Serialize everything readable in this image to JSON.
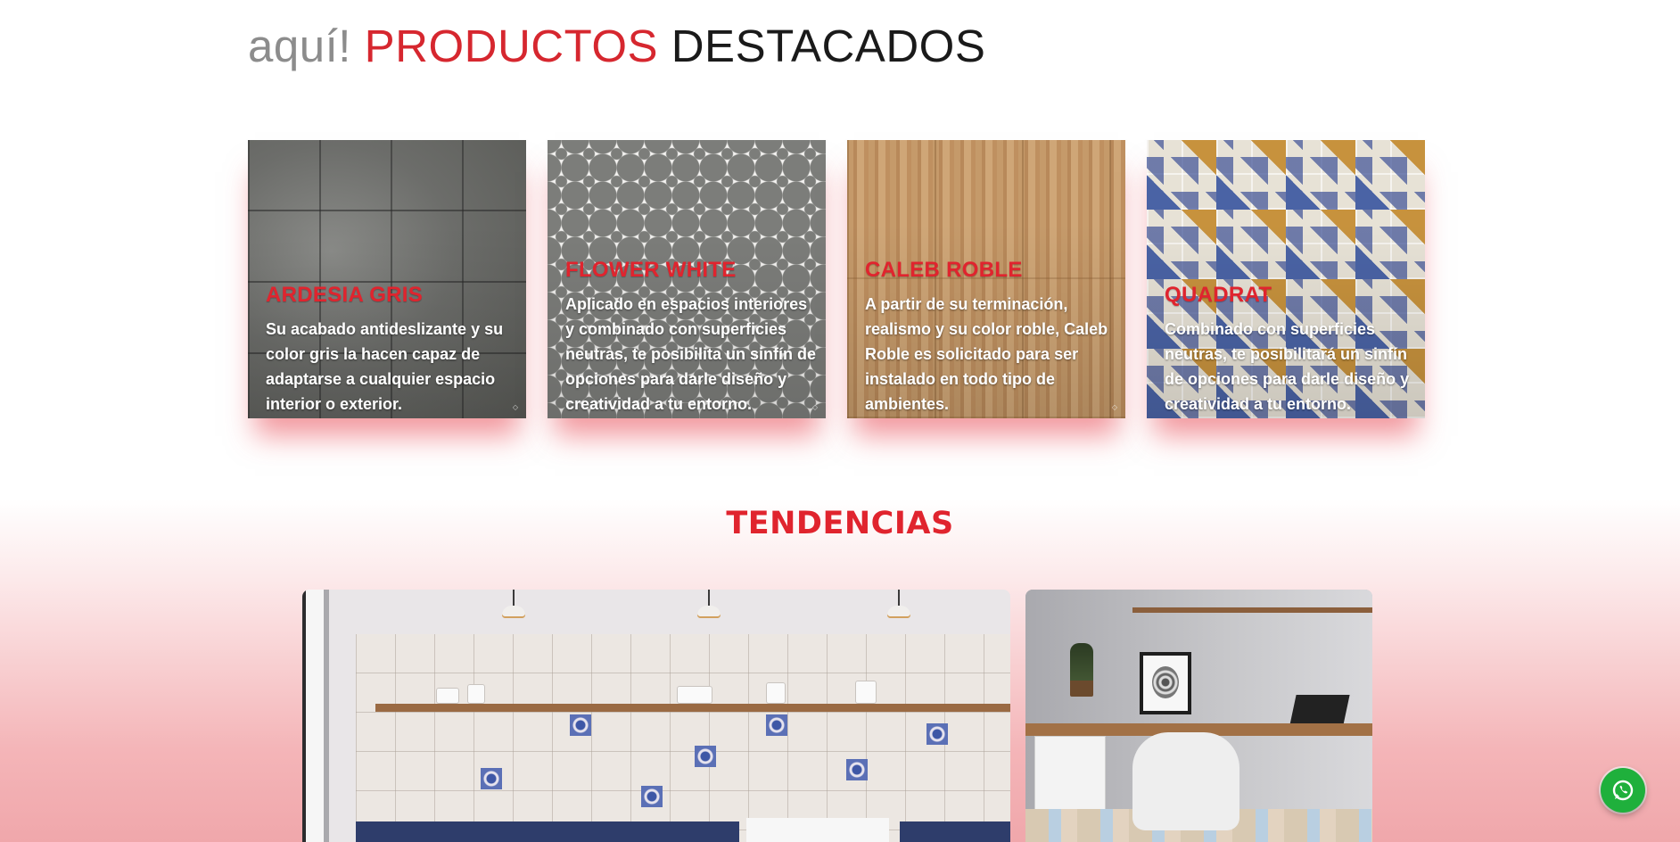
{
  "heading": {
    "word1": "aquí!",
    "word2": "PRODUCTOS",
    "word3": "DESTACADOS"
  },
  "products": [
    {
      "title": "ARDESIA GRIS",
      "description": "Su acabado antideslizante y su color gris la hacen capaz de adaptarse a cualquier espacio interior o exterior.",
      "texture": "gray-slate"
    },
    {
      "title": "FLOWER WHITE",
      "description": "Aplicado en espacios interiores y combinado con superficies neutras, te posibilita un sinfín de opciones para darle diseño y creatividad a tu entorno.",
      "texture": "gray-white-flower-pattern"
    },
    {
      "title": "CALEB ROBLE",
      "description": "A partir de su terminación, realismo y su color roble, Caleb Roble es solicitado para ser instalado en todo tipo de ambientes.",
      "texture": "oak-wood"
    },
    {
      "title": "QUADRAT",
      "description": "Combinado con superficies neutras, te posibilitará un sinfín de opciones para darle diseño y creatividad a tu entorno.",
      "texture": "patchwork-tiles"
    }
  ],
  "tendencias": {
    "title": "TENDENCIAS",
    "images": [
      {
        "subject": "kitchen-with-patterned-tiles"
      },
      {
        "subject": "home-office-desk"
      }
    ]
  },
  "whatsapp": {
    "icon": "whatsapp-icon"
  },
  "colors": {
    "accent": "#e0242e",
    "heading_gray": "#8c8c8c",
    "heading_dark": "#1a1a1a",
    "whatsapp_green": "#1fb03c",
    "card_glow": "#e84650"
  }
}
